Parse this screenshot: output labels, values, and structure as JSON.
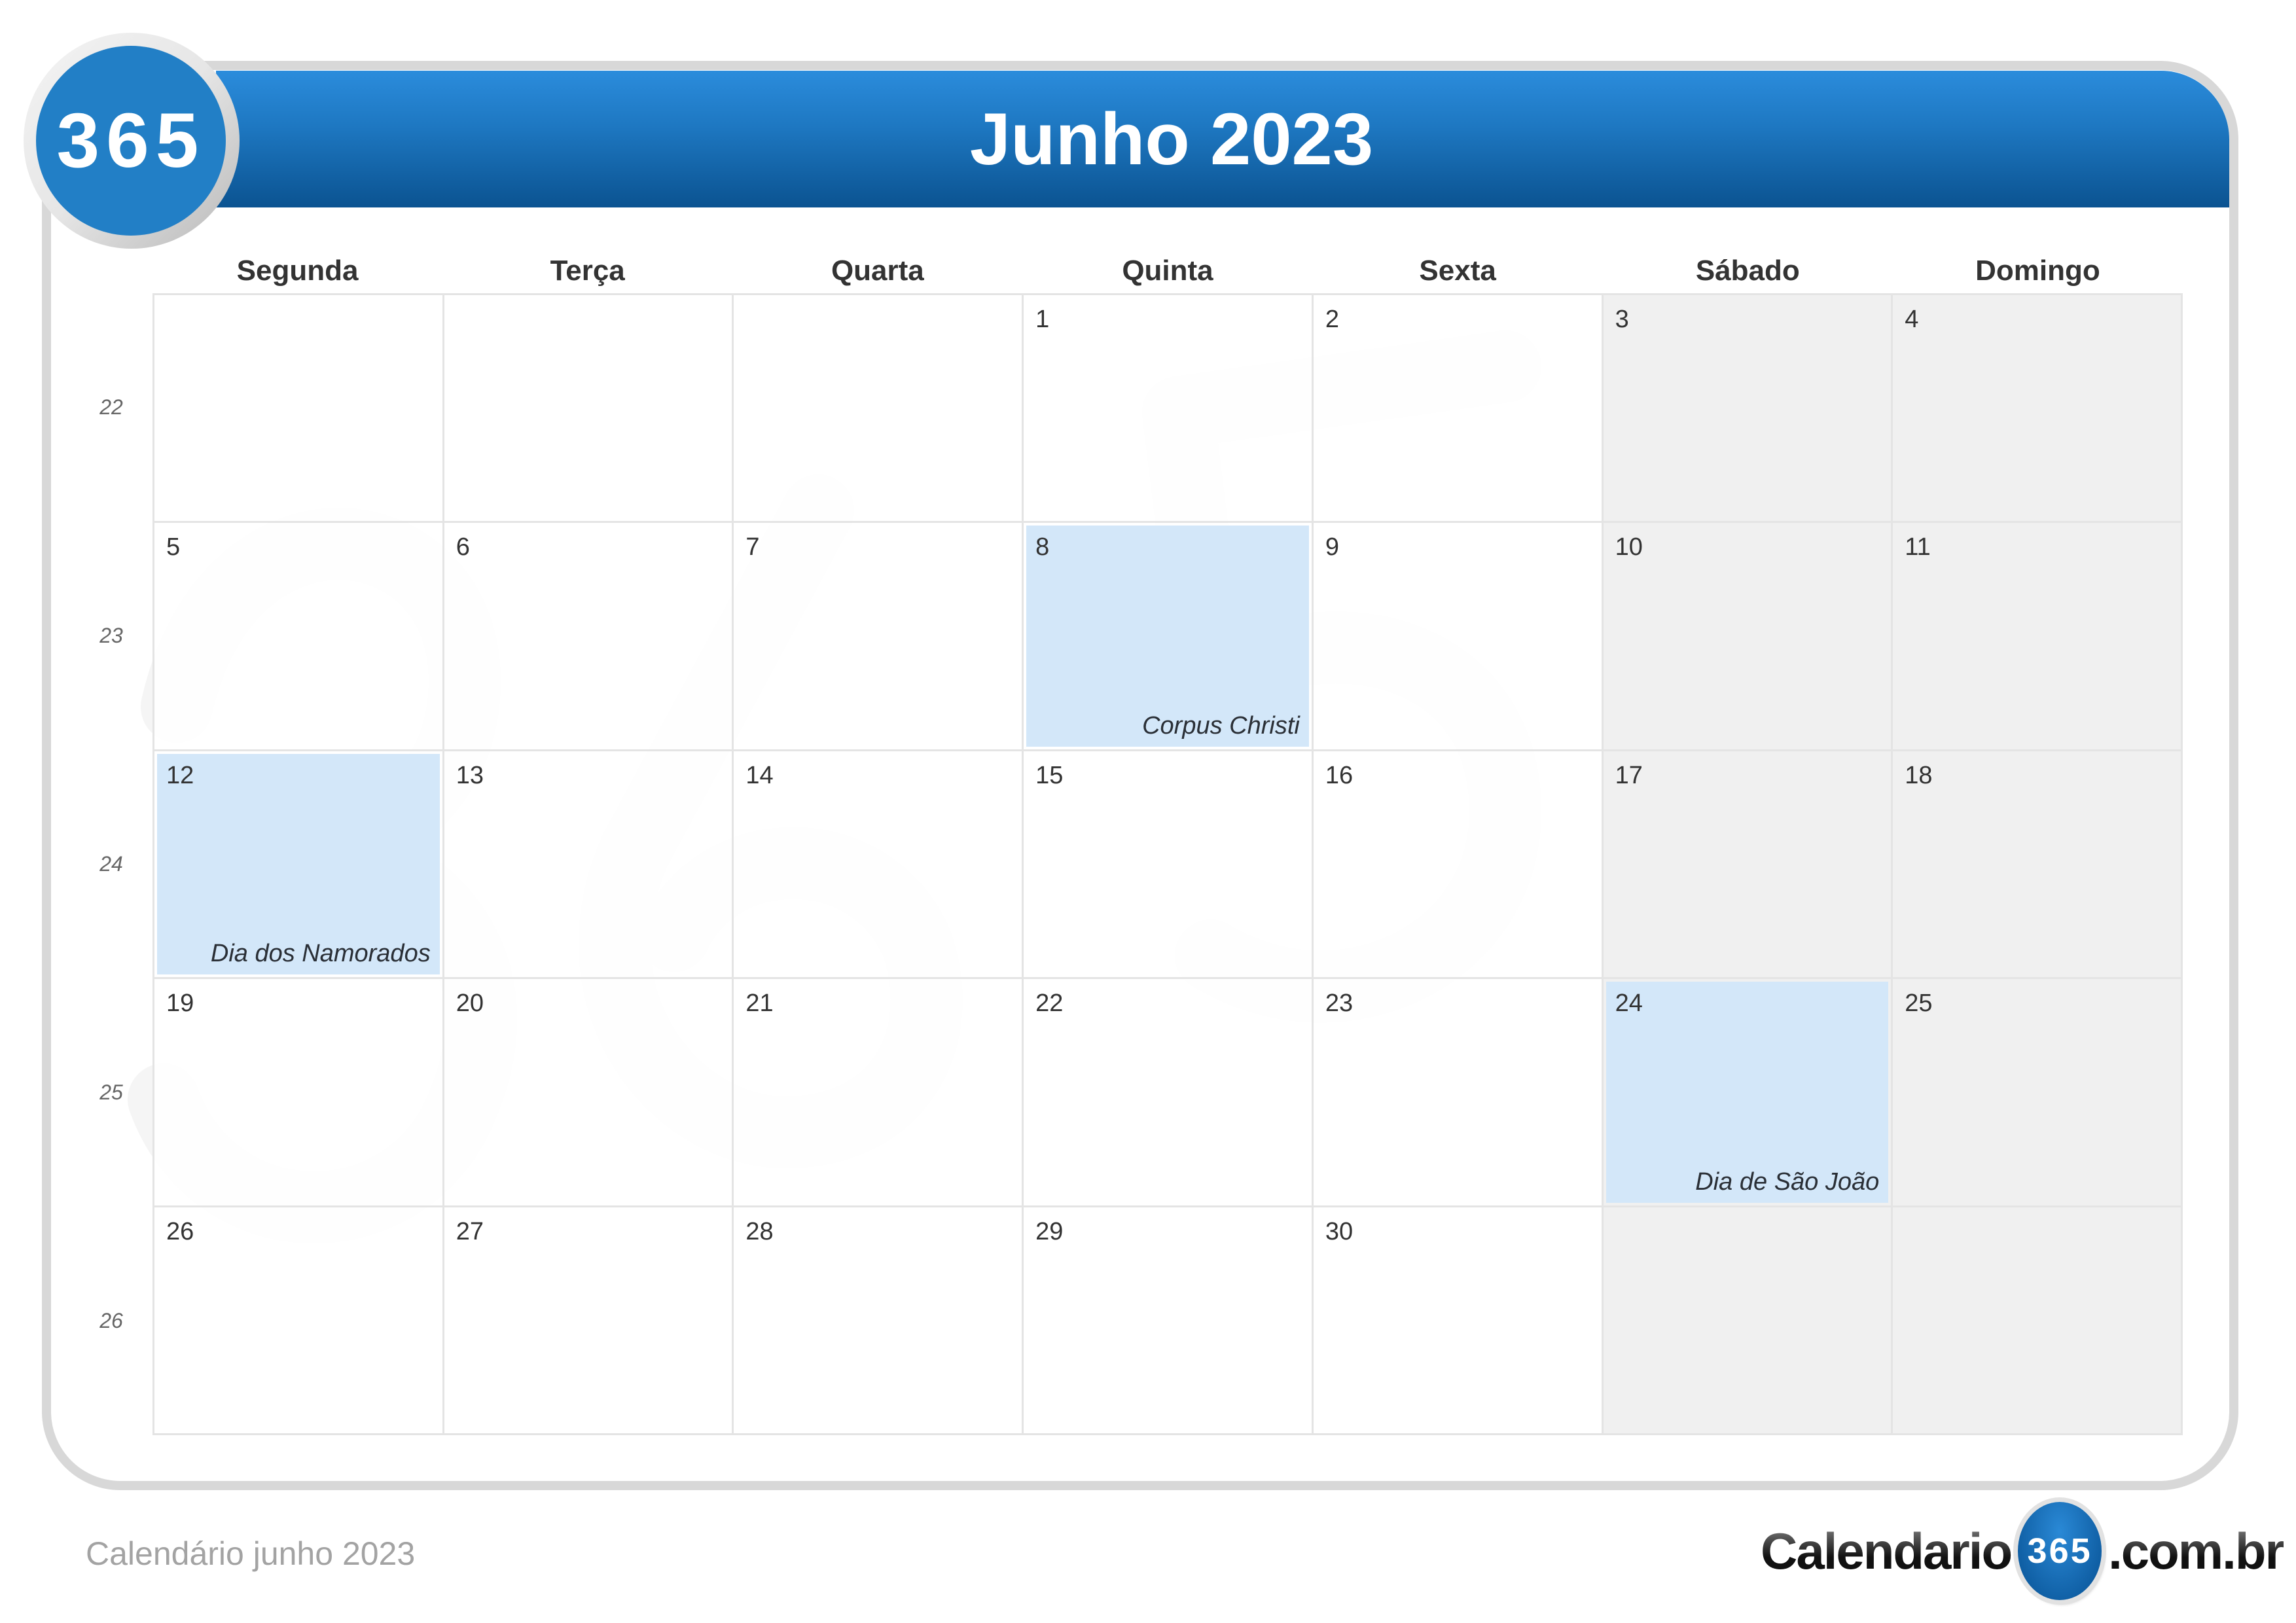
{
  "header": {
    "badge": "365",
    "title": "Junho 2023"
  },
  "colors": {
    "header_blue_top": "#2b8cdc",
    "header_blue_bottom": "#0b5391",
    "holiday_highlight": "#d3e7f9",
    "weekend_fill": "#f0f0f0"
  },
  "weekdays": [
    "Segunda",
    "Terça",
    "Quarta",
    "Quinta",
    "Sexta",
    "Sábado",
    "Domingo"
  ],
  "week_numbers": [
    "22",
    "23",
    "24",
    "25",
    "26"
  ],
  "weeks": [
    [
      {
        "day": ""
      },
      {
        "day": ""
      },
      {
        "day": ""
      },
      {
        "day": "1"
      },
      {
        "day": "2"
      },
      {
        "day": "3"
      },
      {
        "day": "4"
      }
    ],
    [
      {
        "day": "5"
      },
      {
        "day": "6"
      },
      {
        "day": "7"
      },
      {
        "day": "8",
        "holiday": "Corpus Christi"
      },
      {
        "day": "9"
      },
      {
        "day": "10"
      },
      {
        "day": "11"
      }
    ],
    [
      {
        "day": "12",
        "holiday": "Dia dos Namorados"
      },
      {
        "day": "13"
      },
      {
        "day": "14"
      },
      {
        "day": "15"
      },
      {
        "day": "16"
      },
      {
        "day": "17"
      },
      {
        "day": "18"
      }
    ],
    [
      {
        "day": "19"
      },
      {
        "day": "20"
      },
      {
        "day": "21"
      },
      {
        "day": "22"
      },
      {
        "day": "23"
      },
      {
        "day": "24",
        "holiday": "Dia de São João"
      },
      {
        "day": "25"
      }
    ],
    [
      {
        "day": "26"
      },
      {
        "day": "27"
      },
      {
        "day": "28"
      },
      {
        "day": "29"
      },
      {
        "day": "30"
      },
      {
        "day": ""
      },
      {
        "day": ""
      }
    ]
  ],
  "footer": {
    "caption": "Calendário junho 2023",
    "logo_prefix": "Calendario",
    "logo_badge": "365",
    "logo_suffix": ".com.br"
  }
}
